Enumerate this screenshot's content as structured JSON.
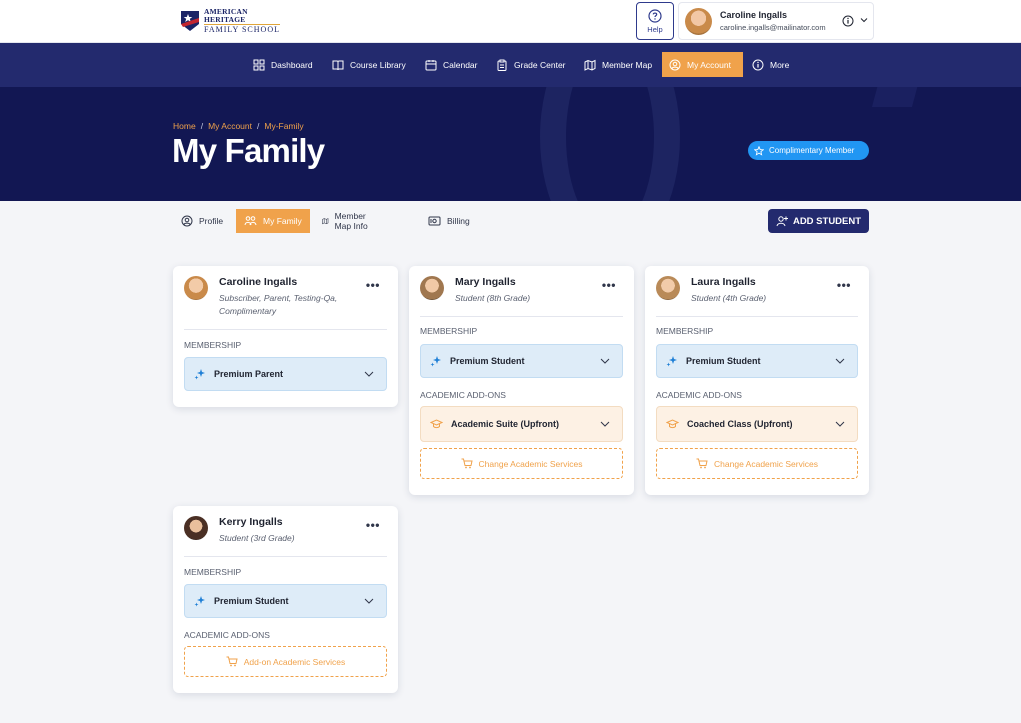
{
  "brand": {
    "line1": "American Heritage",
    "line2": "Family School"
  },
  "header": {
    "help_label": "Help",
    "user_name": "Caroline Ingalls",
    "user_email": "caroline.ingalls@mailinator.com"
  },
  "nav": {
    "items": [
      {
        "label": "Dashboard",
        "icon": "dashboard-icon"
      },
      {
        "label": "Course Library",
        "icon": "book-icon"
      },
      {
        "label": "Calendar",
        "icon": "calendar-icon"
      },
      {
        "label": "Grade Center",
        "icon": "clipboard-icon"
      },
      {
        "label": "Member Map",
        "icon": "map-icon"
      },
      {
        "label": "My Account",
        "icon": "user-circle-icon",
        "active": true
      },
      {
        "label": "More",
        "icon": "info-circle-icon"
      }
    ]
  },
  "hero": {
    "breadcrumb": [
      "Home",
      "My Account",
      "My-Family"
    ],
    "title": "My Family",
    "badge": "Complimentary Member"
  },
  "tabs": [
    {
      "label": "Profile",
      "icon": "user-circle-icon"
    },
    {
      "label": "My Family",
      "icon": "family-icon",
      "active": true
    },
    {
      "label": "Member Map Info",
      "icon": "map-icon"
    },
    {
      "label": "Billing",
      "icon": "billing-icon"
    }
  ],
  "add_student_label": "ADD STUDENT",
  "labels": {
    "membership": "MEMBERSHIP",
    "academic_addons": "ACADEMIC ADD-ONS",
    "change_services": "Change Academic Services",
    "addon_services": "Add-on Academic Services"
  },
  "members": [
    {
      "name": "Caroline Ingalls",
      "role": "Subscriber, Parent, Testing-Qa, Complimentary",
      "membership": "Premium Parent"
    },
    {
      "name": "Mary Ingalls",
      "role": "Student (8th Grade)",
      "membership": "Premium Student",
      "addon": "Academic Suite (Upfront)"
    },
    {
      "name": "Laura Ingalls",
      "role": "Student (4th Grade)",
      "membership": "Premium Student",
      "addon": "Coached Class (Upfront)"
    },
    {
      "name": "Kerry Ingalls",
      "role": "Student (3rd Grade)",
      "membership": "Premium Student"
    }
  ],
  "colors": {
    "navy": "#232a6e",
    "hero": "#121753",
    "accent": "#f0a24b",
    "badge": "#2196f3"
  }
}
